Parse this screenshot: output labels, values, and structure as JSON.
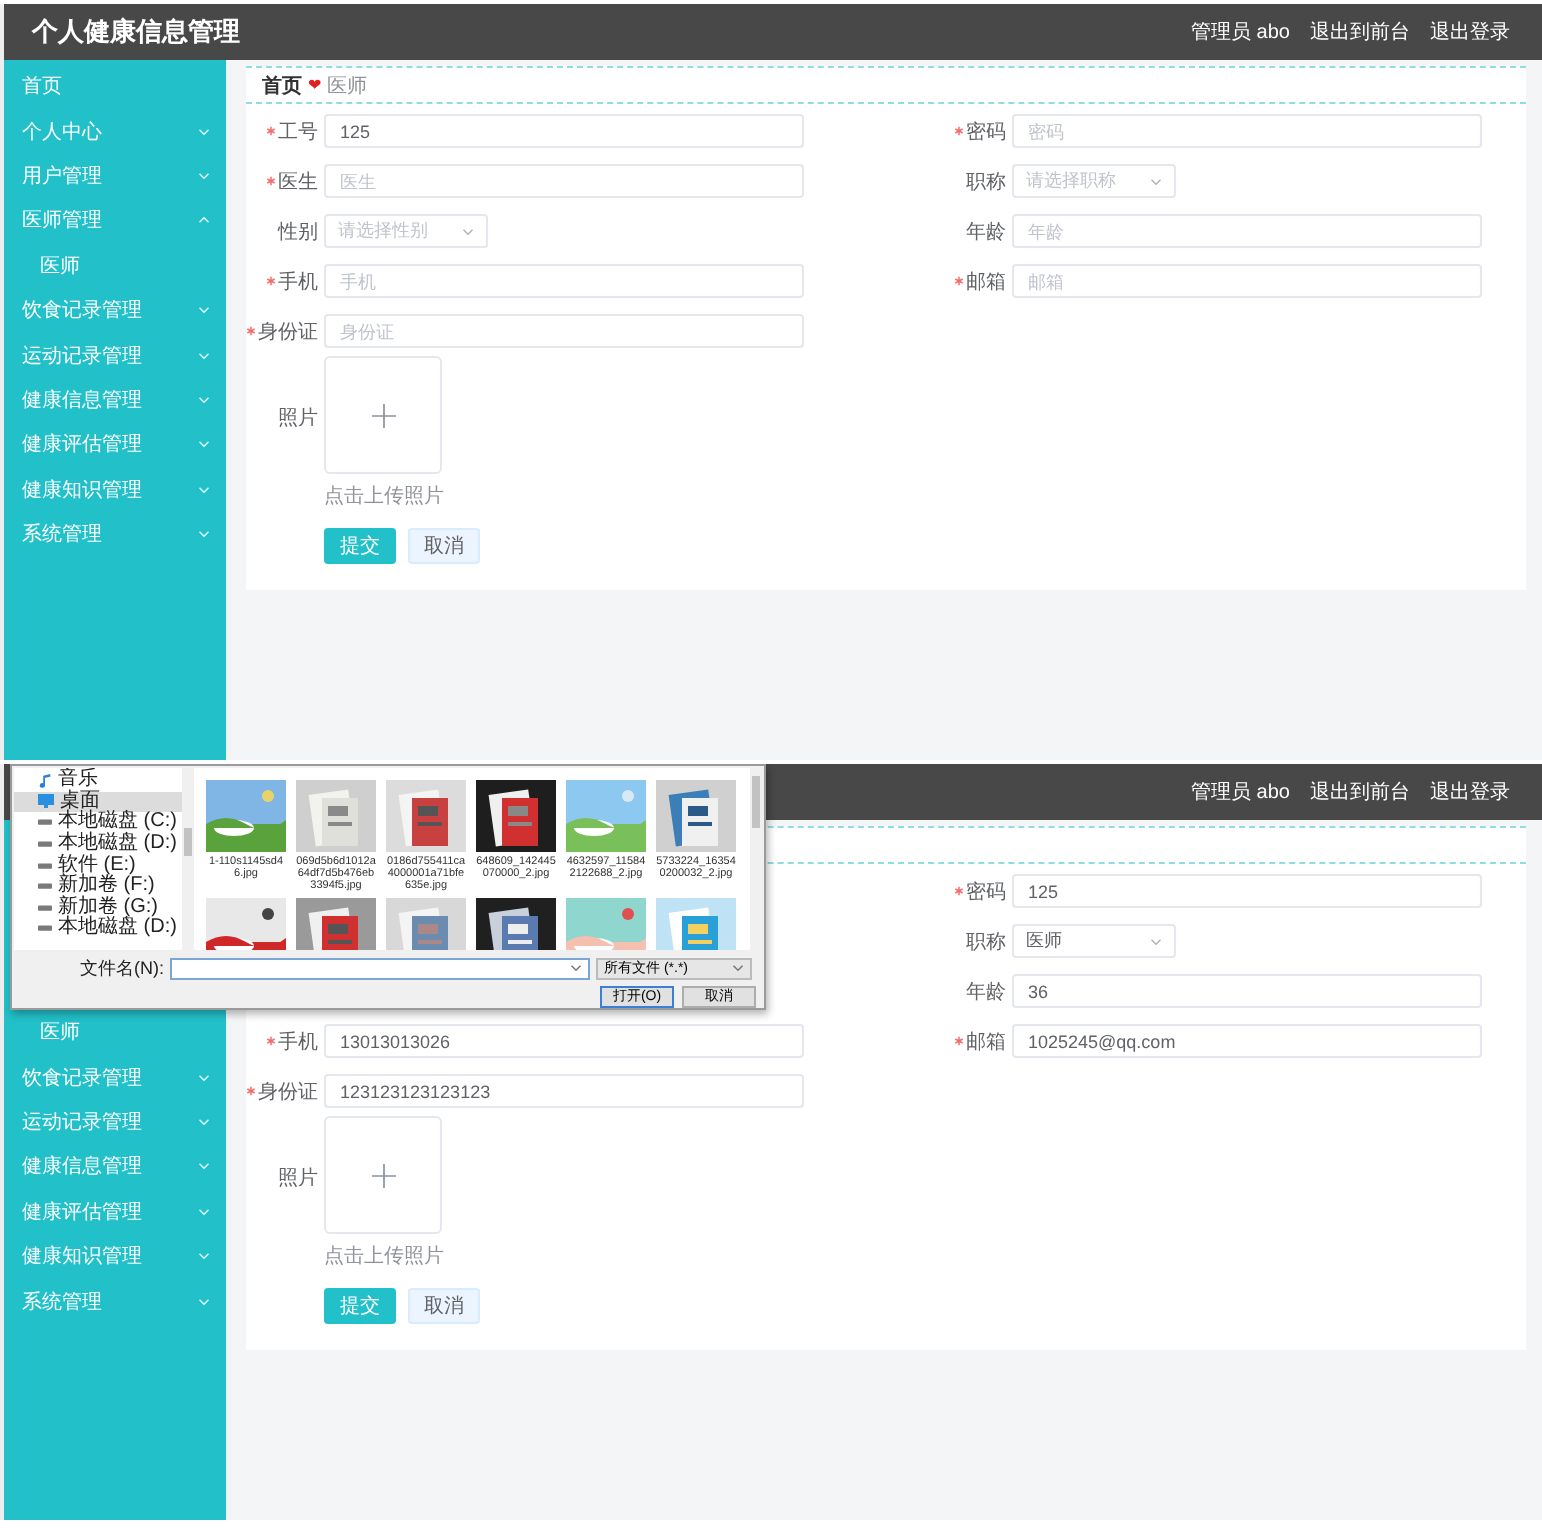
{
  "screens": [
    {
      "header": {
        "title": "个人健康信息管理",
        "links": [
          "管理员 abo",
          "退出到前台",
          "退出登录"
        ]
      },
      "sidebar": [
        {
          "kind": "link",
          "label": "首页"
        },
        {
          "kind": "menu",
          "label": "个人中心",
          "expanded": false
        },
        {
          "kind": "menu",
          "label": "用户管理",
          "expanded": false
        },
        {
          "kind": "menu",
          "label": "医师管理",
          "expanded": true,
          "children": [
            {
              "kind": "link",
              "label": "医师"
            }
          ]
        },
        {
          "kind": "menu",
          "label": "饮食记录管理",
          "expanded": false
        },
        {
          "kind": "menu",
          "label": "运动记录管理",
          "expanded": false
        },
        {
          "kind": "menu",
          "label": "健康信息管理",
          "expanded": false
        },
        {
          "kind": "menu",
          "label": "健康评估管理",
          "expanded": false
        },
        {
          "kind": "menu",
          "label": "健康知识管理",
          "expanded": false
        },
        {
          "kind": "menu",
          "label": "系统管理",
          "expanded": false
        }
      ],
      "breadcrumb": {
        "home": "首页",
        "separator": "❤",
        "current": "医师"
      },
      "form": {
        "rows": [
          {
            "left": {
              "kind": "input",
              "label": "工号",
              "required": true,
              "value": "125"
            },
            "right": {
              "kind": "input",
              "label": "密码",
              "required": true,
              "placeholder": "密码"
            }
          },
          {
            "left": {
              "kind": "input",
              "label": "医生",
              "required": true,
              "placeholder": "医生"
            },
            "right": {
              "kind": "select",
              "label": "职称",
              "required": false,
              "placeholder": "请选择职称"
            }
          },
          {
            "left": {
              "kind": "select",
              "label": "性别",
              "required": false,
              "placeholder": "请选择性别"
            },
            "right": {
              "kind": "input",
              "label": "年龄",
              "required": false,
              "placeholder": "年龄"
            }
          },
          {
            "left": {
              "kind": "input",
              "label": "手机",
              "required": true,
              "placeholder": "手机"
            },
            "right": {
              "kind": "input",
              "label": "邮箱",
              "required": true,
              "placeholder": "邮箱"
            }
          },
          {
            "left": {
              "kind": "input",
              "label": "身份证",
              "required": true,
              "placeholder": "身份证"
            }
          }
        ],
        "upload": {
          "label": "照片",
          "hint": "点击上传照片"
        },
        "buttons": [
          {
            "kind": "primary",
            "label": "提交"
          },
          {
            "kind": "plain",
            "label": "取消"
          }
        ]
      }
    },
    {
      "header": {
        "links": [
          "管理员 abo",
          "退出到前台",
          "退出登录"
        ]
      },
      "sidebar": [
        {
          "kind": "sub",
          "label": "医师"
        },
        {
          "kind": "menu",
          "label": "饮食记录管理",
          "expanded": false
        },
        {
          "kind": "menu",
          "label": "运动记录管理",
          "expanded": false
        },
        {
          "kind": "menu",
          "label": "健康信息管理",
          "expanded": false
        },
        {
          "kind": "menu",
          "label": "健康评估管理",
          "expanded": false
        },
        {
          "kind": "menu",
          "label": "健康知识管理",
          "expanded": false
        },
        {
          "kind": "menu",
          "label": "系统管理",
          "expanded": false
        }
      ],
      "form": {
        "rows": [
          {
            "right": {
              "kind": "input",
              "label": "密码",
              "required": true,
              "value": "125"
            }
          },
          {
            "right": {
              "kind": "select",
              "label": "职称",
              "required": false,
              "value": "医师"
            }
          },
          {
            "right": {
              "kind": "input",
              "label": "年龄",
              "required": false,
              "value": "36"
            }
          },
          {
            "left": {
              "kind": "input",
              "label": "手机",
              "required": true,
              "value": "13013013026"
            },
            "right": {
              "kind": "input",
              "label": "邮箱",
              "required": true,
              "value": "1025245@qq.com"
            }
          },
          {
            "left": {
              "kind": "input",
              "label": "身份证",
              "required": true,
              "value": "123123123123123"
            }
          }
        ],
        "upload": {
          "label": "照片",
          "hint": "点击上传照片"
        },
        "buttons": [
          {
            "kind": "primary",
            "label": "提交"
          },
          {
            "kind": "plain",
            "label": "取消"
          }
        ]
      },
      "file_dialog": {
        "nav": [
          {
            "kind": "music",
            "label": "音乐",
            "selected": false
          },
          {
            "kind": "desktop",
            "label": "桌面",
            "selected": true
          },
          {
            "kind": "drive",
            "label": "本地磁盘 (C:)",
            "selected": false
          },
          {
            "kind": "drive",
            "label": "本地磁盘 (D:)",
            "selected": false
          },
          {
            "kind": "drive",
            "label": "软件 (E:)",
            "selected": false
          },
          {
            "kind": "drive",
            "label": "新加卷 (F:)",
            "selected": false
          },
          {
            "kind": "drive",
            "label": "新加卷 (G:)",
            "selected": false
          },
          {
            "kind": "drive",
            "label": "本地磁盘 (D:)",
            "selected": false
          }
        ],
        "files": [
          {
            "kind": "picture",
            "name": "1-110s1145sd46.jpg"
          },
          {
            "kind": "picture",
            "name": "069d5b6d1012a64df7d5b476eb3394f5.jpg"
          },
          {
            "kind": "picture",
            "name": "0186d755411ca4000001a71bfe635e.jpg"
          },
          {
            "kind": "picture",
            "name": "648609_142445070000_2.jpg"
          },
          {
            "kind": "picture",
            "name": "4632597_115842122688_2.jpg"
          },
          {
            "kind": "picture",
            "name": "5733224_163540200032_2.jpg"
          },
          {
            "kind": "picture"
          },
          {
            "kind": "picture"
          },
          {
            "kind": "picture"
          },
          {
            "kind": "picture"
          },
          {
            "kind": "picture"
          },
          {
            "kind": "picture"
          }
        ],
        "filename_label": "文件名(N):",
        "filetype": "所有文件 (*.*)",
        "buttons": [
          "打开(O)",
          "取消"
        ]
      }
    }
  ]
}
